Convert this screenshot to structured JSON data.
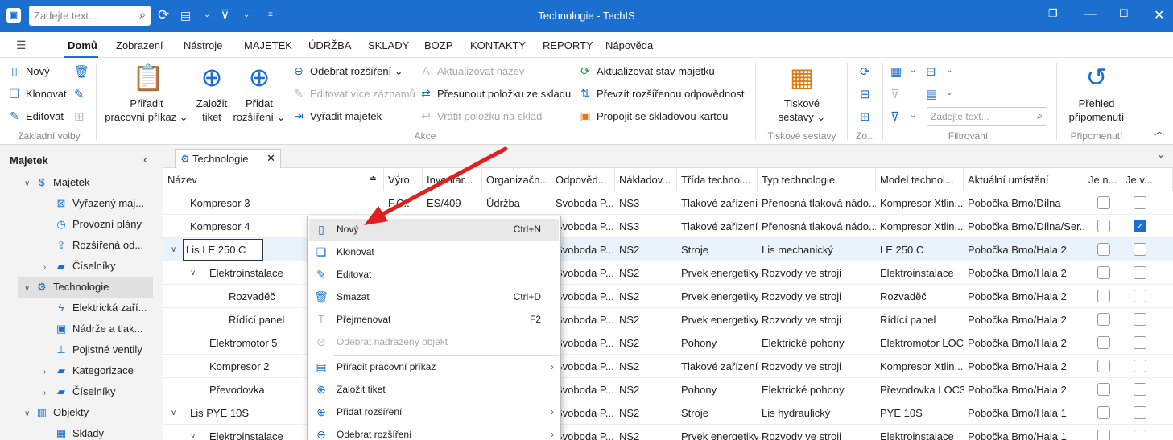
{
  "titlebar": {
    "search_placeholder": "Zadejte text...",
    "title": "Technologie - TechIS",
    "icons": [
      "refresh-icon",
      "clipboard-icon",
      "filter-icon",
      "customize-icon"
    ],
    "window_buttons": [
      "restore-icon",
      "maximize-icon",
      "close-icon"
    ]
  },
  "menu": {
    "items": [
      "Domů",
      "Zobrazení",
      "Nástroje",
      "MAJETEK",
      "ÚDRŽBA",
      "SKLADY",
      "BOZP",
      "KONTAKTY",
      "REPORTY",
      "Nápověda"
    ],
    "active": "Domů"
  },
  "ribbon": {
    "basic": {
      "new": "Nový",
      "clone": "Klonovat",
      "edit": "Editovat",
      "label": "Základní volby"
    },
    "assign_wo": [
      "Přiřadit",
      "pracovní příkaz"
    ],
    "create_ticket": [
      "Založit",
      "tiket"
    ],
    "add_ext": [
      "Přidat",
      "rozšíření"
    ],
    "actions": {
      "remove_ext": "Odebrat rozšíření",
      "edit_multi": "Editovat více záznamů",
      "discard": "Vyřadit majetek",
      "update_name": "Aktualizovat název",
      "move_item": "Přesunout položku ze skladu",
      "return_item": "Vrátit položku na sklad",
      "update_status": "Aktualizovat stav majetku",
      "take_resp": "Převzít rozšířenou odpovědnost",
      "link_card": "Propojit se skladovou kartou",
      "label": "Akce"
    },
    "print": {
      "btn": [
        "Tiskové",
        "sestavy"
      ],
      "label": "Tiskové sestavy"
    },
    "zoom_label": "Zo...",
    "filter": {
      "placeholder": "Zadejte text...",
      "label": "Filtrování"
    },
    "reminders": {
      "btn": [
        "Přehled",
        "připomenutí"
      ],
      "label": "Připomenutí"
    }
  },
  "left_panel": {
    "title": "Majetek",
    "items": [
      {
        "label": "Majetek",
        "icon": "dollar-icon"
      },
      {
        "label": "Vyřazený maj...",
        "icon": "discarded-icon"
      },
      {
        "label": "Provozní plány",
        "icon": "clock-icon"
      },
      {
        "label": "Rozšířená od...",
        "icon": "user-upload-icon"
      },
      {
        "label": "Číselníky",
        "icon": "folder-icon"
      },
      {
        "label": "Technologie",
        "icon": "gears-icon"
      },
      {
        "label": "Elektrická zaří...",
        "icon": "electric-icon"
      },
      {
        "label": "Nádrže a tlak...",
        "icon": "tank-icon"
      },
      {
        "label": "Pojistné ventily",
        "icon": "valve-icon"
      },
      {
        "label": "Kategorizace",
        "icon": "folder-icon"
      },
      {
        "label": "Číselníky",
        "icon": "folder-icon"
      },
      {
        "label": "Objekty",
        "icon": "building-icon"
      },
      {
        "label": "Sklady",
        "icon": "warehouse-icon"
      }
    ]
  },
  "tab": {
    "label": "Technologie"
  },
  "grid": {
    "columns": [
      "Název",
      "Výro",
      "Inventár...",
      "Organizačn...",
      "Odpověd...",
      "Nákladov...",
      "Třída technol...",
      "Typ technologie",
      "Model technol...",
      "Aktuální umístění",
      "Je n...",
      "Je v..."
    ],
    "rows": [
      {
        "name": "Kompresor 3",
        "vyr": "F.C...",
        "inv": "ES/409",
        "org": "Údržba",
        "odp": "Svoboda P...",
        "nak": "NS3",
        "trida": "Tlakové zařízení",
        "typ": "Přenosná tlaková nádo...",
        "model": "Kompresor Xtlin...",
        "umisteni": "Pobočka Brno/Dílna",
        "c1": false,
        "c2": false
      },
      {
        "name": "Kompresor 4",
        "vyr": "",
        "inv": "",
        "org": "",
        "odp": "Svoboda P...",
        "nak": "NS3",
        "trida": "Tlakové zařízení",
        "typ": "Přenosná tlaková nádo...",
        "model": "Kompresor Xtlin...",
        "umisteni": "Pobočka Brno/Dílna/Ser...",
        "c1": false,
        "c2": true
      },
      {
        "name": "Lis LE 250 C",
        "vyr": "",
        "inv": "",
        "org": "",
        "odp": "Svoboda P...",
        "nak": "NS2",
        "trida": "Stroje",
        "typ": "Lis mechanický",
        "model": "LE 250 C",
        "umisteni": "Pobočka Brno/Hala 2",
        "c1": false,
        "c2": false
      },
      {
        "name": "Elektroinstalace",
        "vyr": "",
        "inv": "",
        "org": "",
        "odp": "Svoboda P...",
        "nak": "NS2",
        "trida": "Prvek energetiky",
        "typ": "Rozvody ve stroji",
        "model": "Elektroinstalace",
        "umisteni": "Pobočka Brno/Hala 2",
        "c1": false,
        "c2": false
      },
      {
        "name": "Rozvaděč",
        "vyr": "",
        "inv": "",
        "org": "",
        "odp": "Svoboda P...",
        "nak": "NS2",
        "trida": "Prvek energetiky",
        "typ": "Rozvody ve stroji",
        "model": "Rozvaděč",
        "umisteni": "Pobočka Brno/Hala 2",
        "c1": false,
        "c2": false
      },
      {
        "name": "Řídící panel",
        "vyr": "",
        "inv": "",
        "org": "",
        "odp": "Svoboda P...",
        "nak": "NS2",
        "trida": "Prvek energetiky",
        "typ": "Rozvody ve stroji",
        "model": "Řídící panel",
        "umisteni": "Pobočka Brno/Hala 2",
        "c1": false,
        "c2": false
      },
      {
        "name": "Elektromotor 5",
        "vyr": "",
        "inv": "",
        "org": "",
        "odp": "Svoboda P...",
        "nak": "NS2",
        "trida": "Pohony",
        "typ": "Elektrické pohony",
        "model": "Elektromotor LOC...",
        "umisteni": "Pobočka Brno/Hala 2",
        "c1": false,
        "c2": false
      },
      {
        "name": "Kompresor 2",
        "vyr": "",
        "inv": "",
        "org": "",
        "odp": "Svoboda P...",
        "nak": "NS2",
        "trida": "Tlakové zařízení",
        "typ": "Rozvody ve stroji",
        "model": "Kompresor Xtlin...",
        "umisteni": "Pobočka Brno/Hala 2",
        "c1": false,
        "c2": false
      },
      {
        "name": "Převodovka",
        "vyr": "",
        "inv": "",
        "org": "",
        "odp": "Svoboda P...",
        "nak": "NS2",
        "trida": "Pohony",
        "typ": "Elektrické pohony",
        "model": "Převodovka LOC3",
        "umisteni": "Pobočka Brno/Hala 2",
        "c1": false,
        "c2": false
      },
      {
        "name": "Lis PYE 10S",
        "vyr": "",
        "inv": "",
        "org": "",
        "odp": "Svoboda P...",
        "nak": "NS2",
        "trida": "Stroje",
        "typ": "Lis hydraulický",
        "model": "PYE 10S",
        "umisteni": "Pobočka Brno/Hala 1",
        "c1": false,
        "c2": false
      },
      {
        "name": "Elektroinstalace",
        "vyr": "",
        "inv": "",
        "org": "",
        "odp": "Svoboda P...",
        "nak": "NS2",
        "trida": "Prvek energetiky",
        "typ": "Rozvody ve stroji",
        "model": "Elektroinstalace",
        "umisteni": "Pobočka Brno/Hala 1",
        "c1": false,
        "c2": false
      }
    ]
  },
  "context_menu": {
    "items": [
      {
        "label": "Nový",
        "shortcut": "Ctrl+N",
        "icon": "new-doc-icon"
      },
      {
        "label": "Klonovat",
        "shortcut": "",
        "icon": "clone-icon"
      },
      {
        "label": "Editovat",
        "shortcut": "",
        "icon": "edit-icon"
      },
      {
        "label": "Smazat",
        "shortcut": "Ctrl+D",
        "icon": "trash-icon"
      },
      {
        "label": "Přejmenovat",
        "shortcut": "F2",
        "icon": "rename-icon"
      },
      {
        "label": "Odebrat nadřazený objekt",
        "shortcut": "",
        "icon": "unlink-icon"
      },
      {
        "label": "Přiřadit pracovní příkaz",
        "shortcut": "",
        "icon": "clipboard-icon"
      },
      {
        "label": "Založit tiket",
        "shortcut": "",
        "icon": "zoom-plus-icon"
      },
      {
        "label": "Přidat rozšíření",
        "shortcut": "",
        "icon": "plus-circle-icon"
      },
      {
        "label": "Odebrat rozšíření",
        "shortcut": "",
        "icon": "minus-circle-icon"
      }
    ]
  },
  "colors": {
    "accent": "#1a6fcf",
    "annotation_arrow": "#e02020"
  }
}
